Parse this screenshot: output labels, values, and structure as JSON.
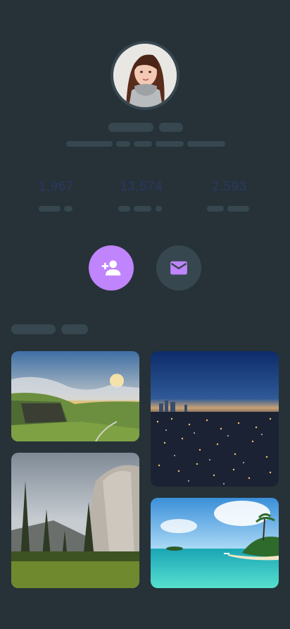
{
  "profile": {
    "avatar_icon": "person-portrait",
    "name_placeholder": "",
    "bio_placeholder": ""
  },
  "stats": [
    {
      "value": "1,967"
    },
    {
      "value": "13,574"
    },
    {
      "value": "2,593"
    }
  ],
  "actions": {
    "follow_icon": "person-add-icon",
    "message_icon": "mail-icon",
    "accent_color": "#c084fc",
    "secondary_color": "#37474f"
  },
  "gallery": {
    "photos": [
      {
        "subject": "mountain-cliff-sunset"
      },
      {
        "subject": "city-night-skyline"
      },
      {
        "subject": "granite-cliff-forest"
      },
      {
        "subject": "tropical-beach"
      }
    ]
  },
  "colors": {
    "background": "#263238",
    "skeleton": "#37474f"
  }
}
